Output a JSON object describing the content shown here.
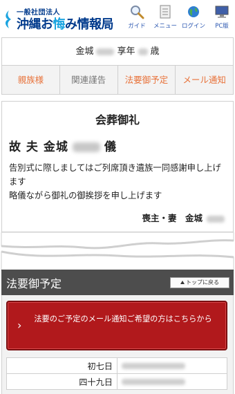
{
  "header": {
    "logo_sub": "一般社団法人",
    "logo_main_pre": "沖縄お",
    "logo_main_highlight": "悔",
    "logo_main_post": "み情報局",
    "nav": [
      {
        "icon": "magnifier-icon",
        "label": "ガイド"
      },
      {
        "icon": "document-menu-icon",
        "label": "メニュー"
      },
      {
        "icon": "globe-icon",
        "label": "ログイン"
      },
      {
        "icon": "monitor-icon",
        "label": "PC版"
      }
    ]
  },
  "profile": {
    "surname": "金城",
    "age_label": "享年",
    "age_suffix": "歳"
  },
  "tabs": [
    {
      "label": "親族様",
      "muted": false
    },
    {
      "label": "関連謹告",
      "muted": true
    },
    {
      "label": "法要御予定",
      "muted": false
    },
    {
      "label": "メール通知",
      "muted": false
    }
  ],
  "message": {
    "title": "会葬御礼",
    "name_prefix": "故 夫 金城",
    "name_suffix": "儀",
    "body_line1": "告別式に際しましてはご列席頂き遺族一同感謝申し上げます",
    "body_line2": "略儀ながら御礼の御挨拶を申し上げます",
    "signature": "喪主・妻　金城"
  },
  "section": {
    "title": "法要御予定",
    "top_button": "トップに戻る",
    "notify_text": "法要のご予定のメール通知ご希望の方はこちらから",
    "schedule": [
      {
        "label": "初七日"
      },
      {
        "label": "四十九日"
      }
    ]
  },
  "colors": {
    "brand_blue": "#003a8c",
    "accent_cyan": "#1aa4e0",
    "tab_orange": "#e8723a",
    "notify_red": "#b1191c",
    "section_dark": "#4d4d4d"
  }
}
